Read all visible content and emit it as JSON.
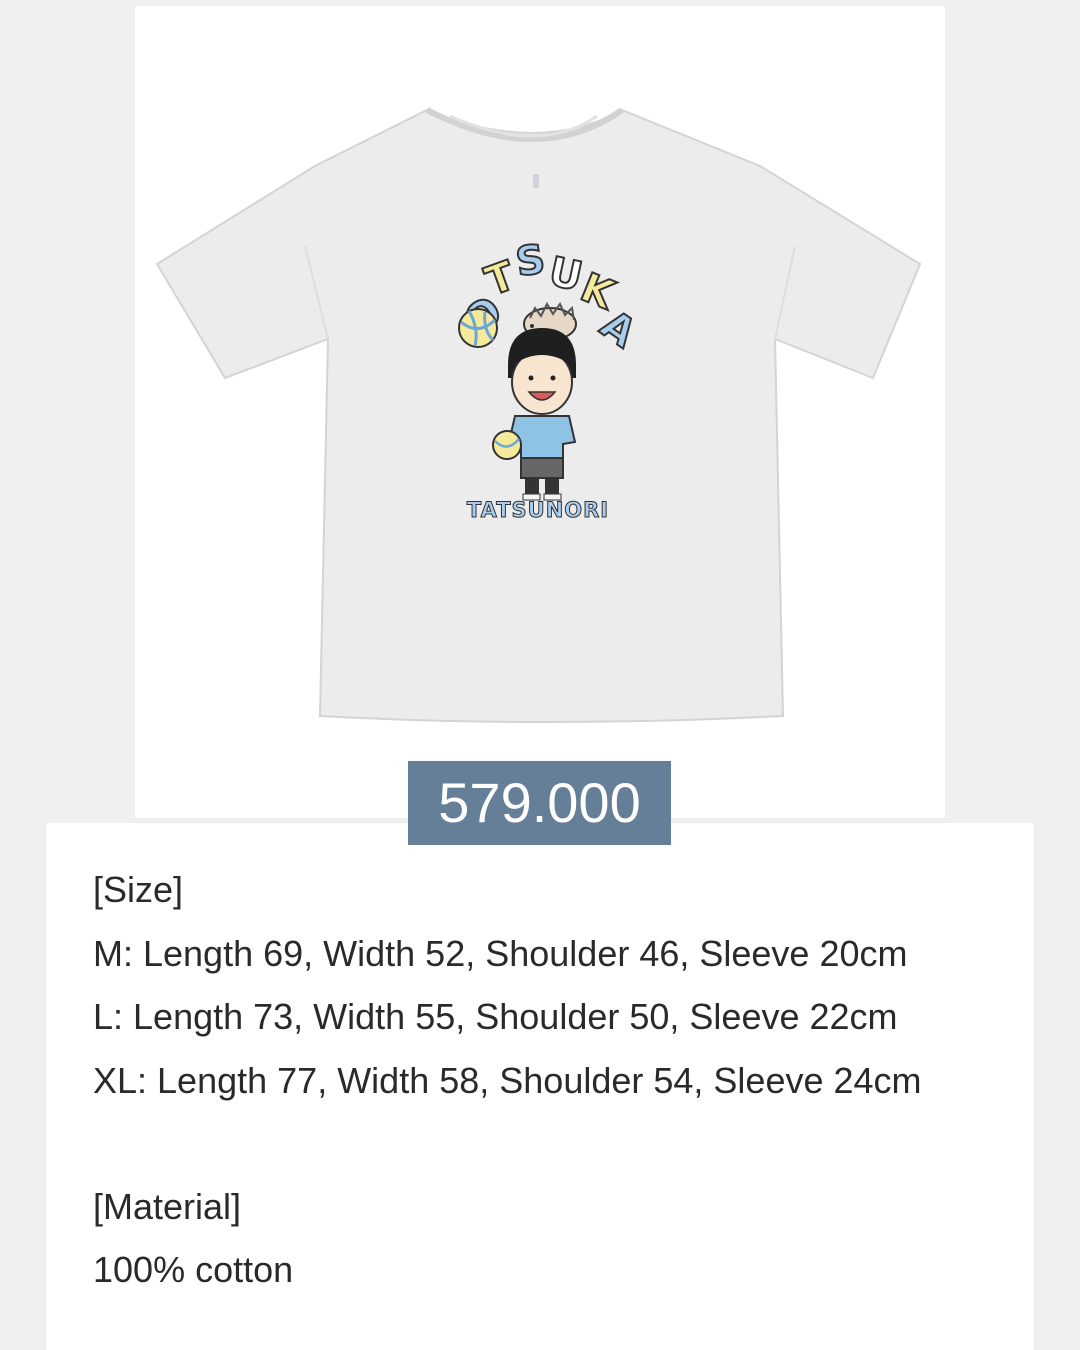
{
  "product": {
    "print_title": "OTSUKA",
    "print_subtitle": "TATSUNORI",
    "price": "579.000"
  },
  "description": {
    "size_header": "[Size]",
    "sizes": [
      "M: Length 69, Width 52, Shoulder 46, Sleeve 20cm",
      "L: Length 73, Width 55, Shoulder 50, Sleeve 22cm",
      "XL: Length 77, Width 58, Shoulder 54, Sleeve 24cm"
    ],
    "material_header": "[Material]",
    "material": "100% cotton"
  },
  "colors": {
    "price_badge_bg": "#667f98",
    "print_blue": "#a9cdee",
    "print_yellow": "#f5ea9a"
  }
}
